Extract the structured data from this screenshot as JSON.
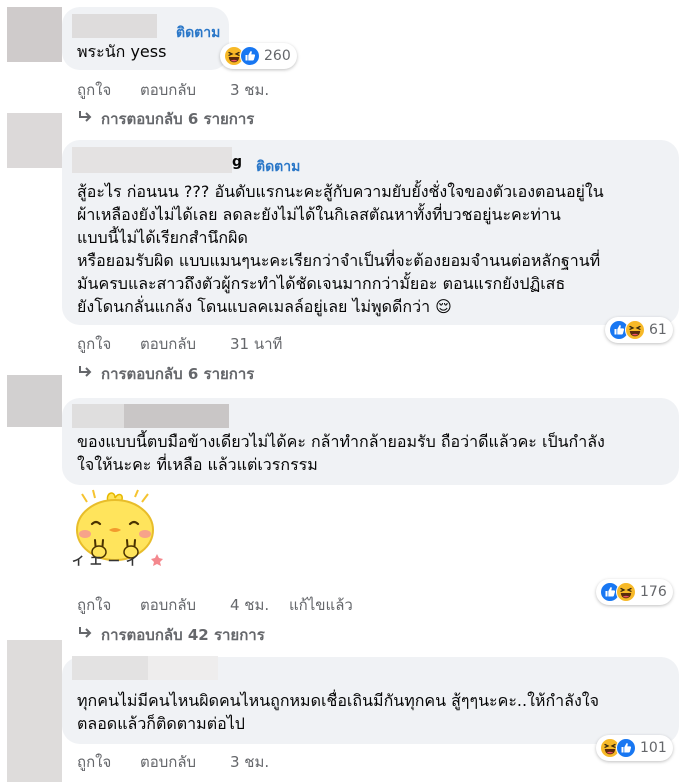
{
  "follow_label": "ติดตาม",
  "like_label": "ถูกใจ",
  "reply_label": "ตอบกลับ",
  "colors": {
    "link": "#2a77c8",
    "meta": "#65676b",
    "bubble": "#f0f2f5",
    "like_blue": "#1877f2",
    "haha_yellow": "#f7b928"
  },
  "comments": [
    {
      "lines": [
        "พระนัก yess"
      ],
      "reactions": {
        "icons": [
          "haha-icon",
          "like-icon"
        ],
        "count": "260"
      },
      "time": "3 ชม.",
      "replies": "การตอบกลับ 6 รายการ"
    },
    {
      "name_suffix": "g",
      "lines": [
        "สู้อะไร ก่อนนน ??? อันดับแรกนะคะสู้กับความยับยั้งชั่งใจของตัวเองตอนอยู่ใน",
        "ผ้าเหลืองยังไม่ได้เลย ลดละยังไม่ได้ในกิเลสตัณหาทั้งที่บวชอยู่นะคะท่าน",
        "แบบนี้ไม่ได้เรียกสำนึกผิด",
        "หรือยอมรับผิด แบบแมนๆนะคะเรียกว่าจำเป็นที่จะต้องยอมจำนนต่อหลักฐานที่",
        "มันครบและสาวถึงตัวผู้กระทำได้ชัดเจนมากกว่ามั้ยอะ ตอนแรกยังปฏิเสธ",
        "ยังโดนกลั่นแกล้ง โดนแบลคเมลล์อยู่เลย ไม่พูดดีกว่า 😌"
      ],
      "reactions": {
        "icons": [
          "like-icon",
          "haha-icon"
        ],
        "count": "61"
      },
      "time": "31 นาที",
      "replies": "การตอบกลับ 6 รายการ"
    },
    {
      "lines": [
        "ของแบบนี้ตบมือข้างเดียวไม่ได้คะ กล้าทำกล้ายอมรับ ถือว่าดีแล้วคะ เป็นกำลัง",
        "ใจให้นะคะ ที่เหลือ แล้วแต่เวรกรรม"
      ],
      "sticker_text": "イエーイ",
      "reactions": {
        "icons": [
          "like-icon",
          "haha-icon"
        ],
        "count": "176"
      },
      "time": "4 ชม.",
      "edited": "แก้ไขแล้ว",
      "replies": "การตอบกลับ 42 รายการ"
    },
    {
      "lines": [
        "ทุกคนไม่มีคนไหนผิดคนไหนถูกหมดเชื่อเถินมีกันทุกคน สู้ๆๆนะคะ..ให้กำลังใจ",
        "ตลอดแล้วก็ติดตามต่อไป"
      ],
      "reactions": {
        "icons": [
          "haha-icon",
          "like-icon"
        ],
        "count": "101"
      },
      "time": "3 ชม."
    }
  ]
}
